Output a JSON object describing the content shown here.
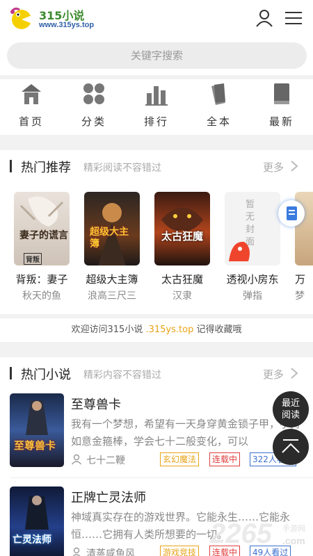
{
  "header": {
    "logo_name": "315小说",
    "logo_url": "www.315ys.top"
  },
  "search": {
    "placeholder": "关键字搜索"
  },
  "nav": [
    {
      "label": "首页",
      "icon": "home-icon"
    },
    {
      "label": "分类",
      "icon": "category-grid-icon"
    },
    {
      "label": "排行",
      "icon": "ranking-bars-icon"
    },
    {
      "label": "全本",
      "icon": "complete-books-icon"
    },
    {
      "label": "最新",
      "icon": "latest-book-icon"
    }
  ],
  "recommend": {
    "title": "热门推荐",
    "subtitle": "精彩阅读不容错过",
    "more": "更多",
    "books": [
      {
        "title": "背叛：妻子",
        "author": "秋天的鱼",
        "cover_text": "妻子的谎言",
        "cover_sub": "背叛"
      },
      {
        "title": "超级大主簿",
        "author": "浪高三尺三",
        "cover_text": "超级大主簿"
      },
      {
        "title": "太古狂魔",
        "author": "汉隶",
        "cover_text": "太古狂魔"
      },
      {
        "title": "透视小房东",
        "author": "弹指",
        "cover_text": "暂无封面"
      },
      {
        "title": "万",
        "author": "梦"
      }
    ]
  },
  "welcome": {
    "prefix": "欢迎访问315小说",
    "domain": ".315ys.top",
    "suffix": "记得收藏哦"
  },
  "hot": {
    "title": "热门小说",
    "subtitle": "精彩内容不容错过",
    "more": "更多",
    "novels": [
      {
        "title": "至尊兽卡",
        "desc": "我有一个梦想，希望有一天身穿黄金锁子甲，手持如意金箍棒，学会七十二般变化，可以",
        "author": "七十二鞭",
        "genre": "玄幻魔法",
        "status": "连载中",
        "readers": "322人看过",
        "cover_text": "至尊兽卡"
      },
      {
        "title": "正牌亡灵法师",
        "desc": "神域真实存在的游戏世界。它能永生……它能永恒……它拥有人类所想要的一切。",
        "author": "清蒸咸鱼风",
        "genre": "游戏竞技",
        "status": "连载中",
        "readers": "49人看过",
        "cover_text": "亡灵法师"
      }
    ]
  },
  "fab": {
    "recent": "最近\n阅读"
  },
  "watermark": {
    "text": "2265",
    "sub": "手游网",
    "url": ".com"
  },
  "colors": {
    "tag_genre": "#e8a317",
    "tag_status": "#e03c3c",
    "tag_readers": "#3b6fd0",
    "highlight": "#e8a317",
    "logo_green": "#3d8b2f"
  }
}
